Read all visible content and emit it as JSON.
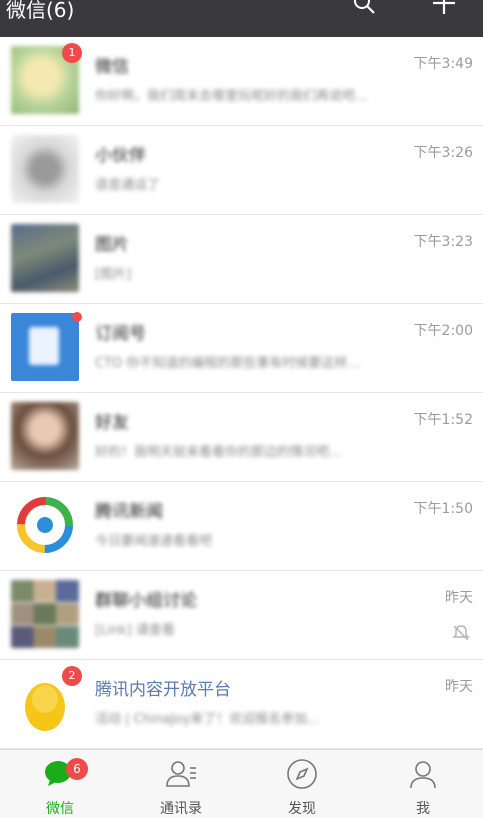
{
  "header": {
    "title": "微信(6)"
  },
  "chats": [
    {
      "name": "微信",
      "preview": "你好啊，我们周末去哪里玩呢好的我们再说吧...",
      "time": "下午3:49",
      "badge": "1"
    },
    {
      "name": "小伙伴",
      "preview": "语音通话了",
      "time": "下午3:26"
    },
    {
      "name": "图片",
      "preview": "[图片]",
      "time": "下午3:23"
    },
    {
      "name": "订阅号",
      "preview": "CTO 你不知道的编程的那些事有时候要这样...",
      "time": "下午2:00"
    },
    {
      "name": "好友",
      "preview": "好的！我明天就来看看你的那边的情况吧...",
      "time": "下午1:52"
    },
    {
      "name": "腾讯新闻",
      "preview": "今日要闻速递看看吧",
      "time": "下午1:50"
    },
    {
      "name": "群聊小组讨论",
      "preview": "[Link] 请查看",
      "time": "昨天"
    },
    {
      "name": "腾讯内容开放平台",
      "preview": "活动 | ChinaJoy来了！欢迎报名参加...",
      "time": "昨天",
      "badge": "2"
    }
  ],
  "tabbar": {
    "items": [
      {
        "label": "微信",
        "badge": "6"
      },
      {
        "label": "通讯录"
      },
      {
        "label": "发现"
      },
      {
        "label": "我"
      }
    ]
  },
  "colors": {
    "header_bg": "#3a3a3c",
    "accent": "#1aad19",
    "badge": "#f04b4b"
  }
}
